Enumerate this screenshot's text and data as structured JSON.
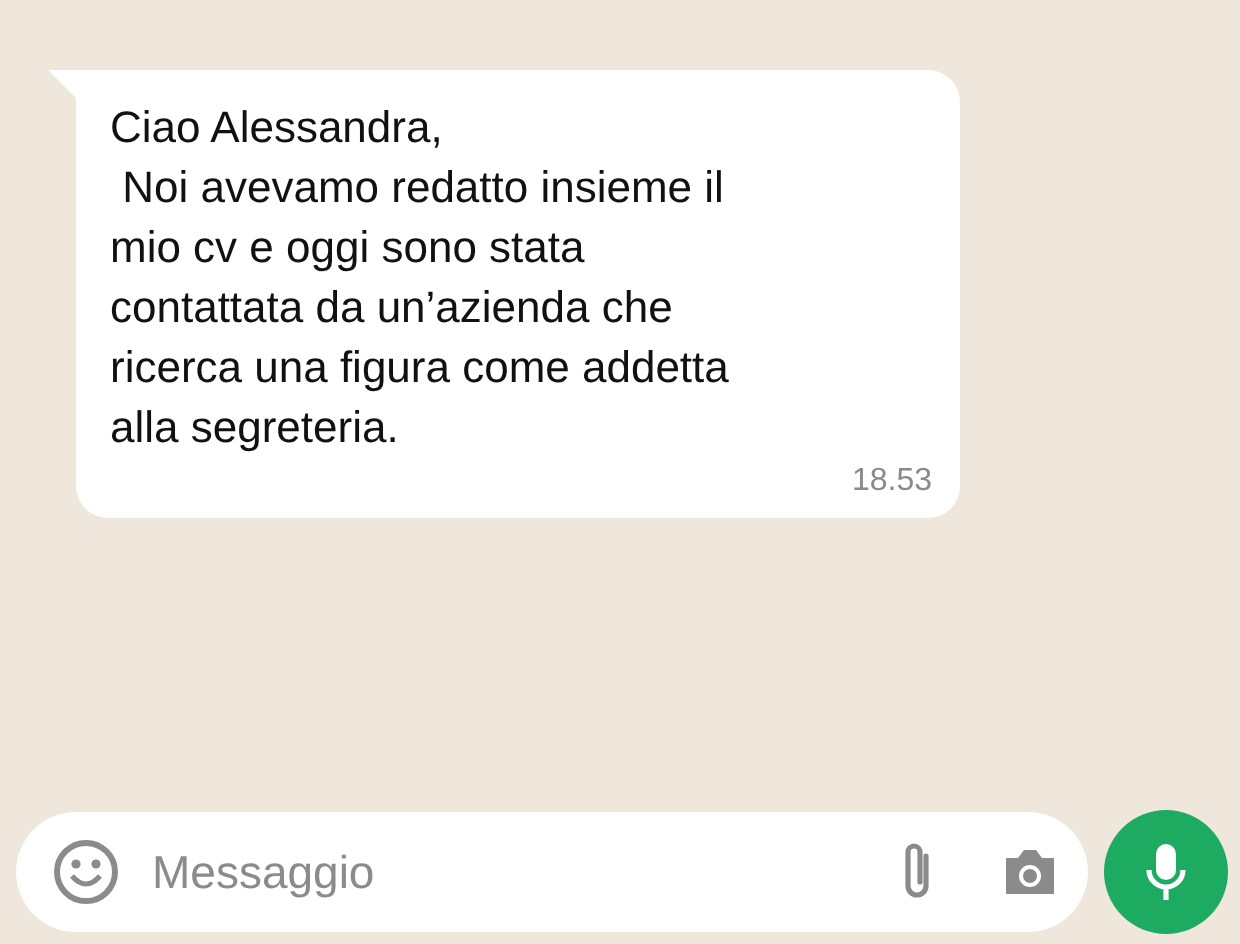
{
  "message": {
    "text": "Ciao Alessandra,\n Noi avevamo redatto insieme il mio cv e oggi sono stata contattata da un’azienda che ricerca una figura come addetta alla segreteria.",
    "time": "18.53"
  },
  "composer": {
    "placeholder": "Messaggio"
  }
}
